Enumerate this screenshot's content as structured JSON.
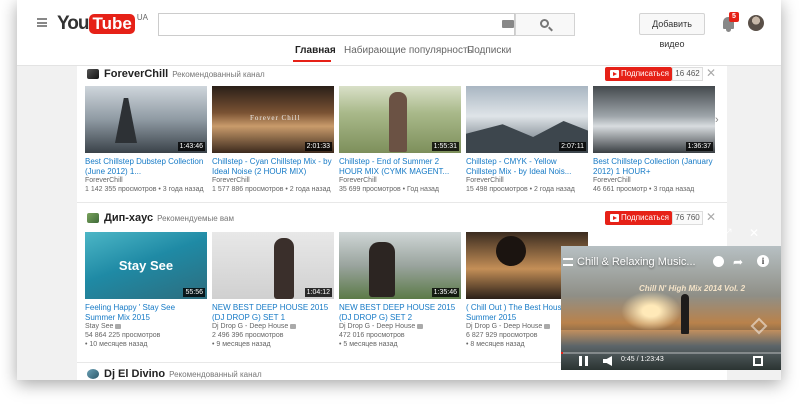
{
  "masthead": {
    "logo_you": "You",
    "logo_tube": "Tube",
    "logo_region": "UA",
    "upload_label": "Добавить видео",
    "notifications_count": "5"
  },
  "tabs": [
    "Главная",
    "Набирающие популярность",
    "Подписки"
  ],
  "shelves": [
    {
      "channel": "ForeverChill",
      "type": "Рекомендованный канал",
      "subscribe_label": "Подписаться",
      "subscribers": "16 462",
      "videos": [
        {
          "title": "Best Chillstep Dubstep Collection (June 2012) 1...",
          "channel": "ForeverChill",
          "views": "1 142 355 просмотров",
          "age": "3 года назад",
          "duration": "1:43:46"
        },
        {
          "title": "Chillstep - Cyan Chillstep Mix - by Ideal Noise (2 HOUR MIX)",
          "channel": "ForeverChill",
          "views": "1 577 886 просмотров",
          "age": "2 года назад",
          "duration": "2:01:33"
        },
        {
          "title": "Chillstep - End of Summer 2 HOUR MIX (CYMK MAGENT...",
          "channel": "ForeverChill",
          "views": "35 699 просмотров",
          "age": "Год назад",
          "duration": "1:55:31"
        },
        {
          "title": "Chillstep - CMYK - Yellow Chillstep Mix - by Ideal Nois...",
          "channel": "ForeverChill",
          "views": "15 498 просмотров",
          "age": "2 года назад",
          "duration": "2:07:11"
        },
        {
          "title": "Best Chillstep Collection (January 2012) 1 HOUR+",
          "channel": "ForeverChill",
          "views": "46 661 просмотр",
          "age": "3 года назад",
          "duration": "1:36:37"
        }
      ]
    },
    {
      "channel": "Дип-хаус",
      "type": "Рекомендуемые вам",
      "subscribe_label": "Подписаться",
      "subscribers": "76 760",
      "videos": [
        {
          "title": "Feeling Happy ' Stay See Summer Mix 2015",
          "channel": "Stay See",
          "views": "54 864 225 просмотров",
          "age": "10 месяцев назад",
          "duration": "55:56",
          "thumb_text": "Stay See"
        },
        {
          "title": "NEW BEST DEEP HOUSE 2015 (DJ DROP G) SET 1",
          "channel": "Dj Drop G - Deep House",
          "views": "2 496 396 просмотров",
          "age": "9 месяцев назад",
          "duration": "1:04:12"
        },
        {
          "title": "NEW BEST DEEP HOUSE 2015 (DJ DROP G) SET 2",
          "channel": "Dj Drop G - Deep House",
          "views": "472 016 просмотров",
          "age": "5 месяцев назад",
          "duration": "1:35:46"
        },
        {
          "title": "( Chill Out ) The Best House Summer 2015",
          "channel": "Dj Drop G - Deep House",
          "views": "6 827 929 просмотров",
          "age": "8 месяцев назад",
          "duration": ""
        }
      ]
    },
    {
      "channel": "Dj El Divino",
      "type": "Рекомендованный канал"
    }
  ],
  "miniplayer": {
    "title": "Chill & Relaxing Music...",
    "overlay_text": "Chill N' High Mix 2014 Vol. 2",
    "time": "0:45 / 1:23:43",
    "progress": 0.009
  }
}
